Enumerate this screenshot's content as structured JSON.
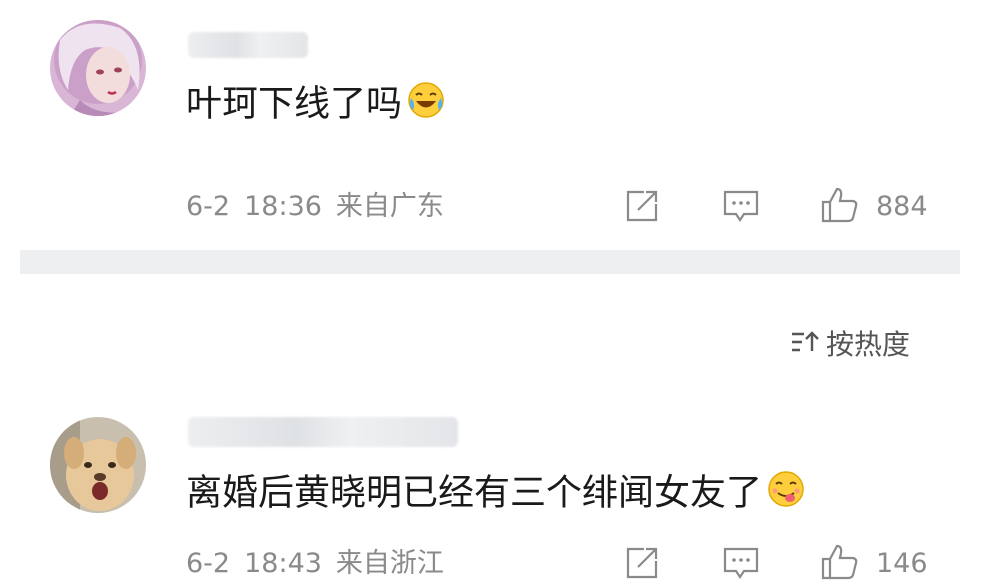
{
  "comments": [
    {
      "text": "叶珂下线了吗",
      "date": "6-2",
      "time": "18:36",
      "location": "来自广东",
      "like_count": "884",
      "emoji": "laugh-cry-emoji",
      "avatar": "anime-avatar"
    },
    {
      "text": "离婚后黄晓明已经有三个绯闻女友了",
      "date": "6-2",
      "time": "18:43",
      "location": "来自浙江",
      "like_count": "146",
      "emoji": "yum-emoji",
      "avatar": "dog-avatar"
    }
  ],
  "sort": {
    "label": "按热度",
    "icon": "sort-icon"
  },
  "colors": {
    "meta_gray": "#8a8a8a",
    "divider": "#eeeff1"
  }
}
